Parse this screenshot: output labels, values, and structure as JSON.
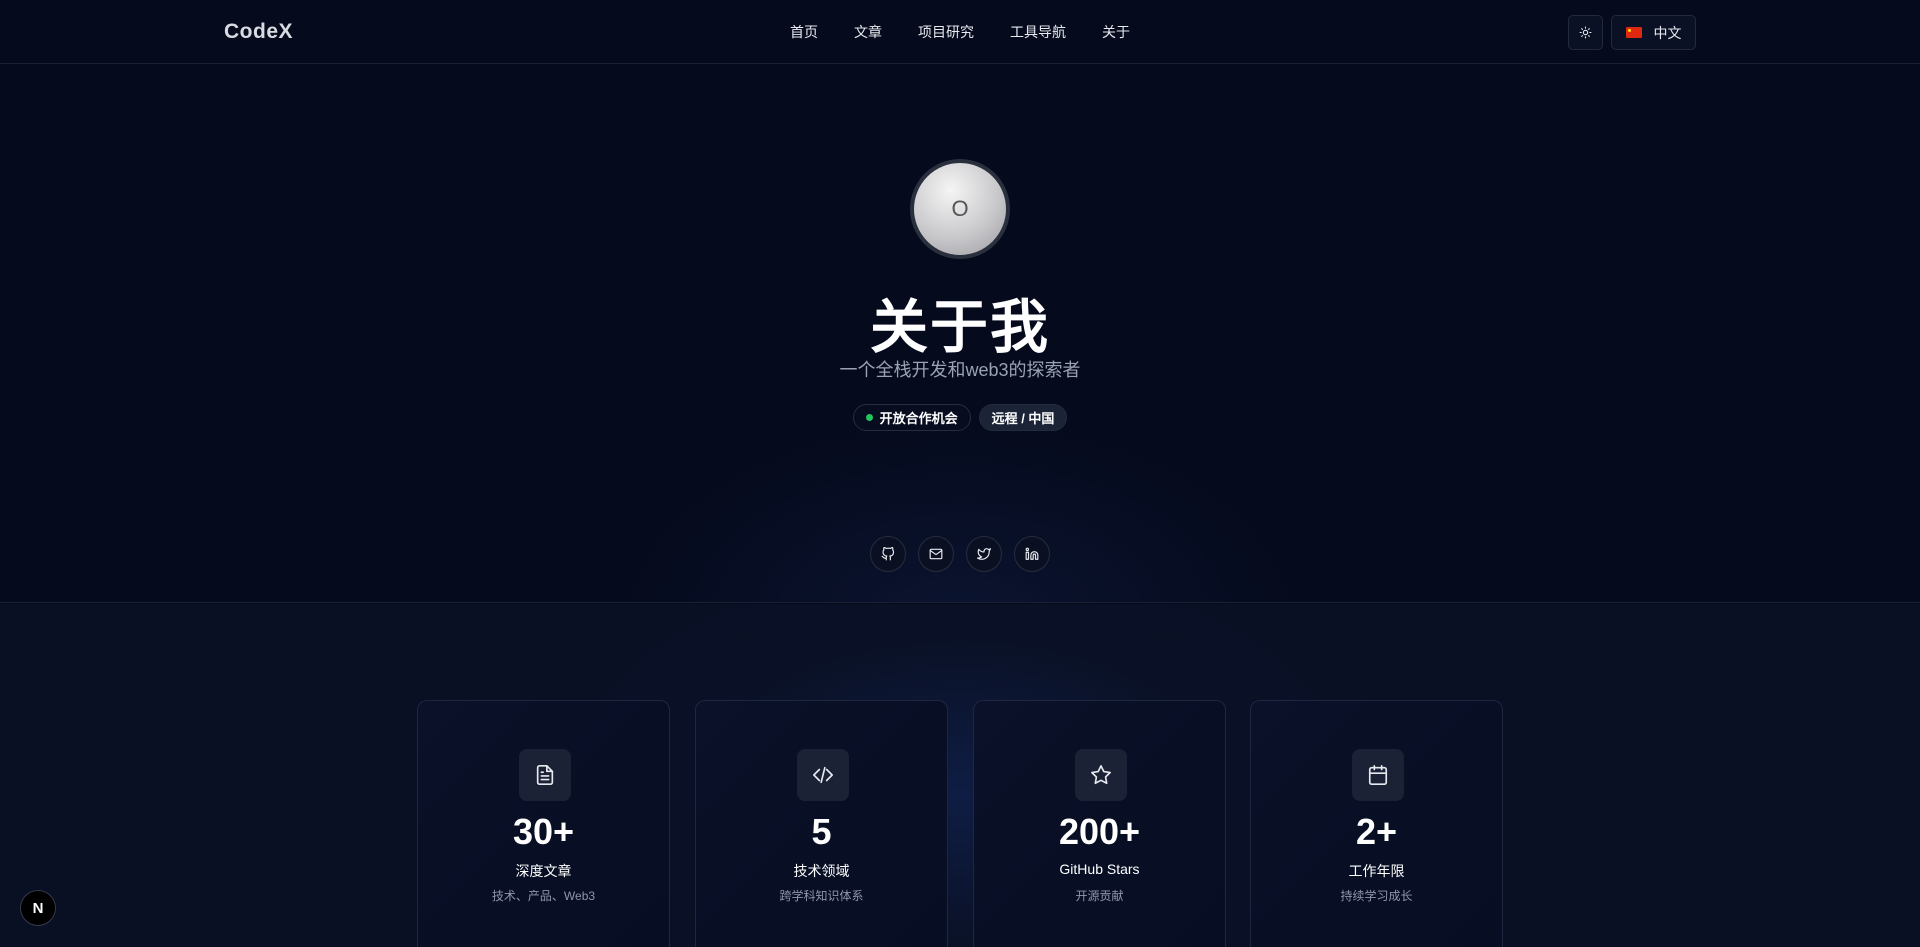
{
  "header": {
    "logo": "CodeX",
    "nav": [
      "首页",
      "文章",
      "项目研究",
      "工具导航",
      "关于"
    ],
    "theme_icon": "sun-icon",
    "language": "中文",
    "language_flag": "china-flag-icon"
  },
  "hero": {
    "avatar_letter": "O",
    "title": "关于我",
    "subtitle": "一个全栈开发和web3的探索者",
    "status_badge": "开放合作机会",
    "location_badge": "远程 / 中国",
    "socials": [
      "github-icon",
      "mail-icon",
      "twitter-icon",
      "linkedin-icon"
    ]
  },
  "stats": [
    {
      "icon": "document-icon",
      "value": "30+",
      "label": "深度文章",
      "desc": "技术、产品、Web3"
    },
    {
      "icon": "code-icon",
      "value": "5",
      "label": "技术领域",
      "desc": "跨学科知识体系"
    },
    {
      "icon": "star-icon",
      "value": "200+",
      "label": "GitHub Stars",
      "desc": "开源贡献"
    },
    {
      "icon": "calendar-icon",
      "value": "2+",
      "label": "工作年限",
      "desc": "持续学习成长"
    }
  ],
  "dev_badge": "N",
  "colors": {
    "background": "#050a1c",
    "status_dot": "#22c55e",
    "card_border": "#1e2740"
  }
}
